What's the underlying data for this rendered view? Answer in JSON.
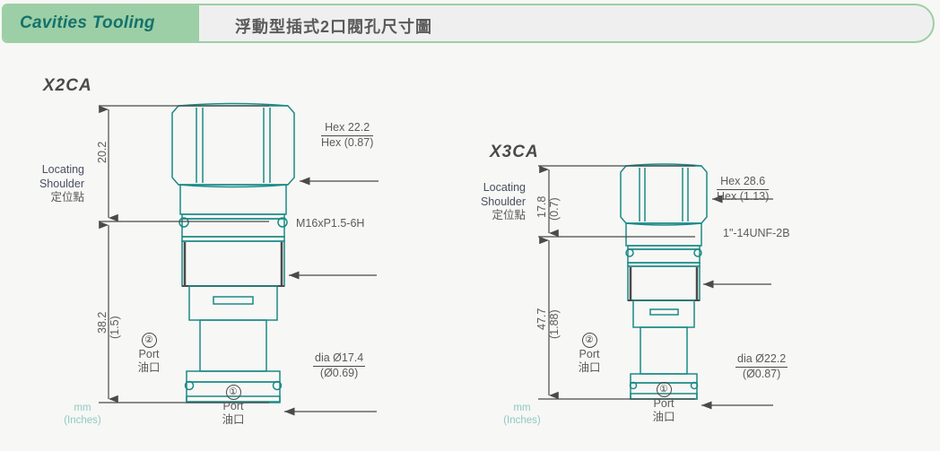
{
  "header": {
    "pill_label": "Cavities Tooling",
    "subtitle": "浮動型插式2口閥孔尺寸圖"
  },
  "parts": [
    {
      "title": "X2CA",
      "shoulder_label_line1": "Locating",
      "shoulder_label_line2": "Shoulder",
      "shoulder_label_cn": "定位點",
      "dim_upper_mm": "20.2",
      "dim_lower_mm": "38.2",
      "dim_lower_in": "(1.5)",
      "callout_hex_top": "Hex  22.2",
      "callout_hex_bottom": "Hex  (0.87)",
      "callout_thread": "M16xP1.5-6H",
      "callout_dia_top": "dia  Ø17.4",
      "callout_dia_bottom": "(Ø0.69)",
      "port2_num": "②",
      "port2_label": "Port",
      "port2_cn": "油口",
      "port1_num": "①",
      "port1_label": "Port",
      "port1_cn": "油口",
      "units_line1": "mm",
      "units_line2": "(Inches)"
    },
    {
      "title": "X3CA",
      "shoulder_label_line1": "Locating",
      "shoulder_label_line2": "Shoulder",
      "shoulder_label_cn": "定位點",
      "dim_upper_mm": "17.8",
      "dim_upper_in": "(0.7)",
      "dim_lower_mm": "47.7",
      "dim_lower_in": "(1.88)",
      "callout_hex_top": "Hex  28.6",
      "callout_hex_bottom": "Hex  (1.13)",
      "callout_thread": "1\"-14UNF-2B",
      "callout_dia_top": "dia  Ø22.2",
      "callout_dia_bottom": "(Ø0.87)",
      "port2_num": "②",
      "port2_label": "Port",
      "port2_cn": "油口",
      "port1_num": "①",
      "port1_label": "Port",
      "port1_cn": "油口",
      "units_line1": "mm",
      "units_line2": "(Inches)"
    }
  ],
  "colors": {
    "pill_bg": "#9ccfa5",
    "pill_text": "#14726c",
    "line_teal": "#1a8a87",
    "dim_line": "#4a4a4a",
    "units_text": "#8fc9c2",
    "page_bg": "#f7f7f5"
  }
}
